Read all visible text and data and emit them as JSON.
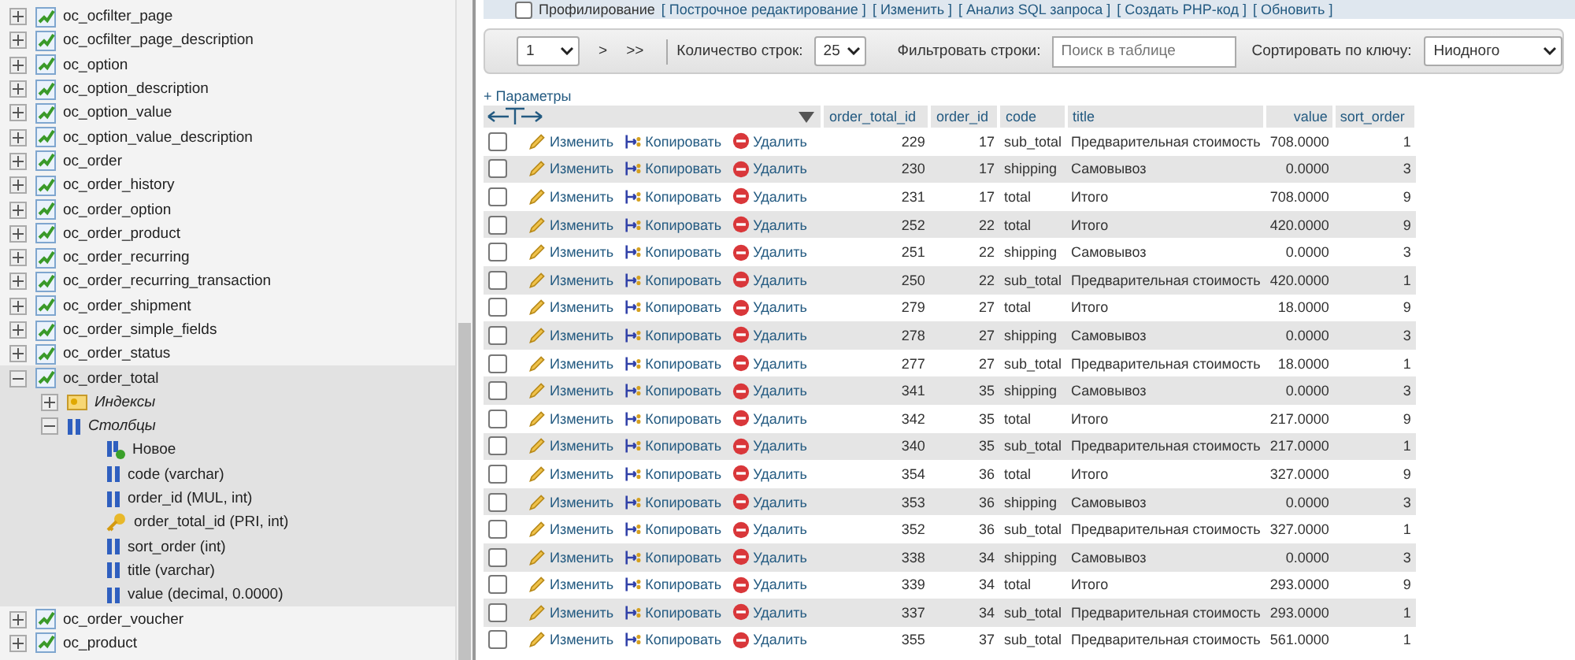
{
  "sidebar": {
    "items": [
      {
        "kind": "table",
        "name": "oc_ocfilter_page",
        "expanded": false
      },
      {
        "kind": "table",
        "name": "oc_ocfilter_page_description",
        "expanded": false
      },
      {
        "kind": "table",
        "name": "oc_option",
        "expanded": false
      },
      {
        "kind": "table",
        "name": "oc_option_description",
        "expanded": false
      },
      {
        "kind": "table",
        "name": "oc_option_value",
        "expanded": false
      },
      {
        "kind": "table",
        "name": "oc_option_value_description",
        "expanded": false
      },
      {
        "kind": "table",
        "name": "oc_order",
        "expanded": false
      },
      {
        "kind": "table",
        "name": "oc_order_history",
        "expanded": false
      },
      {
        "kind": "table",
        "name": "oc_order_option",
        "expanded": false
      },
      {
        "kind": "table",
        "name": "oc_order_product",
        "expanded": false
      },
      {
        "kind": "table",
        "name": "oc_order_recurring",
        "expanded": false
      },
      {
        "kind": "table",
        "name": "oc_order_recurring_transaction",
        "expanded": false
      },
      {
        "kind": "table",
        "name": "oc_order_shipment",
        "expanded": false
      },
      {
        "kind": "table",
        "name": "oc_order_simple_fields",
        "expanded": false
      },
      {
        "kind": "table",
        "name": "oc_order_status",
        "expanded": false
      },
      {
        "kind": "table",
        "name": "oc_order_total",
        "expanded": true,
        "children": [
          {
            "kind": "indexes",
            "name": "Индексы",
            "expanded": false
          },
          {
            "kind": "columns",
            "name": "Столбцы",
            "expanded": true,
            "children": [
              {
                "kind": "new",
                "name": "Новое"
              },
              {
                "kind": "column",
                "name": "code (varchar)"
              },
              {
                "kind": "column",
                "name": "order_id (MUL, int)"
              },
              {
                "kind": "key",
                "name": "order_total_id (PRI, int)"
              },
              {
                "kind": "column",
                "name": "sort_order (int)"
              },
              {
                "kind": "column",
                "name": "title (varchar)"
              },
              {
                "kind": "column",
                "name": "value (decimal, 0.0000)"
              }
            ]
          }
        ]
      },
      {
        "kind": "table",
        "name": "oc_order_voucher",
        "expanded": false
      },
      {
        "kind": "table",
        "name": "oc_product",
        "expanded": false
      }
    ]
  },
  "top_links": {
    "checkbox_checked": false,
    "checkbox_label": "Профилирование",
    "links": [
      "[ Построчное редактирование ]",
      "[ Изменить ]",
      "[ Анализ SQL запроса ]",
      "[ Создать PHP-код ]",
      "[ Обновить ]"
    ]
  },
  "navigation": {
    "page": "1",
    "next": ">",
    "last": ">>",
    "rows_label": "Количество строк:",
    "rows_value": "25",
    "filter_label": "Фильтровать строки:",
    "filter_placeholder": "Поиск в таблице",
    "sort_label": "Сортировать по ключу:",
    "sort_value": "Ниодного"
  },
  "options_link": "+ Параметры",
  "table": {
    "columns": [
      "order_total_id",
      "order_id",
      "code",
      "title",
      "value",
      "sort_order"
    ],
    "rows": [
      {
        "checked": false,
        "edit": "Изменить",
        "copy": "Копировать",
        "delete": "Удалить",
        "cells": [
          "229",
          "17",
          "sub_total",
          "Предварительная стоимость",
          "708.0000",
          "1"
        ]
      },
      {
        "checked": false,
        "edit": "Изменить",
        "copy": "Копировать",
        "delete": "Удалить",
        "cells": [
          "230",
          "17",
          "shipping",
          "Самовывоз",
          "0.0000",
          "3"
        ]
      },
      {
        "checked": false,
        "edit": "Изменить",
        "copy": "Копировать",
        "delete": "Удалить",
        "cells": [
          "231",
          "17",
          "total",
          "Итого",
          "708.0000",
          "9"
        ]
      },
      {
        "checked": false,
        "edit": "Изменить",
        "copy": "Копировать",
        "delete": "Удалить",
        "cells": [
          "252",
          "22",
          "total",
          "Итого",
          "420.0000",
          "9"
        ]
      },
      {
        "checked": false,
        "edit": "Изменить",
        "copy": "Копировать",
        "delete": "Удалить",
        "cells": [
          "251",
          "22",
          "shipping",
          "Самовывоз",
          "0.0000",
          "3"
        ]
      },
      {
        "checked": false,
        "edit": "Изменить",
        "copy": "Копировать",
        "delete": "Удалить",
        "cells": [
          "250",
          "22",
          "sub_total",
          "Предварительная стоимость",
          "420.0000",
          "1"
        ]
      },
      {
        "checked": false,
        "edit": "Изменить",
        "copy": "Копировать",
        "delete": "Удалить",
        "cells": [
          "279",
          "27",
          "total",
          "Итого",
          "18.0000",
          "9"
        ]
      },
      {
        "checked": false,
        "edit": "Изменить",
        "copy": "Копировать",
        "delete": "Удалить",
        "cells": [
          "278",
          "27",
          "shipping",
          "Самовывоз",
          "0.0000",
          "3"
        ]
      },
      {
        "checked": false,
        "edit": "Изменить",
        "copy": "Копировать",
        "delete": "Удалить",
        "cells": [
          "277",
          "27",
          "sub_total",
          "Предварительная стоимость",
          "18.0000",
          "1"
        ]
      },
      {
        "checked": false,
        "edit": "Изменить",
        "copy": "Копировать",
        "delete": "Удалить",
        "cells": [
          "341",
          "35",
          "shipping",
          "Самовывоз",
          "0.0000",
          "3"
        ]
      },
      {
        "checked": false,
        "edit": "Изменить",
        "copy": "Копировать",
        "delete": "Удалить",
        "cells": [
          "342",
          "35",
          "total",
          "Итого",
          "217.0000",
          "9"
        ]
      },
      {
        "checked": false,
        "edit": "Изменить",
        "copy": "Копировать",
        "delete": "Удалить",
        "cells": [
          "340",
          "35",
          "sub_total",
          "Предварительная стоимость",
          "217.0000",
          "1"
        ]
      },
      {
        "checked": false,
        "edit": "Изменить",
        "copy": "Копировать",
        "delete": "Удалить",
        "cells": [
          "354",
          "36",
          "total",
          "Итого",
          "327.0000",
          "9"
        ]
      },
      {
        "checked": false,
        "edit": "Изменить",
        "copy": "Копировать",
        "delete": "Удалить",
        "cells": [
          "353",
          "36",
          "shipping",
          "Самовывоз",
          "0.0000",
          "3"
        ]
      },
      {
        "checked": false,
        "edit": "Изменить",
        "copy": "Копировать",
        "delete": "Удалить",
        "cells": [
          "352",
          "36",
          "sub_total",
          "Предварительная стоимость",
          "327.0000",
          "1"
        ]
      },
      {
        "checked": false,
        "edit": "Изменить",
        "copy": "Копировать",
        "delete": "Удалить",
        "cells": [
          "338",
          "34",
          "shipping",
          "Самовывоз",
          "0.0000",
          "3"
        ]
      },
      {
        "checked": false,
        "edit": "Изменить",
        "copy": "Копировать",
        "delete": "Удалить",
        "cells": [
          "339",
          "34",
          "total",
          "Итого",
          "293.0000",
          "9"
        ]
      },
      {
        "checked": false,
        "edit": "Изменить",
        "copy": "Копировать",
        "delete": "Удалить",
        "cells": [
          "337",
          "34",
          "sub_total",
          "Предварительная стоимость",
          "293.0000",
          "1"
        ]
      },
      {
        "checked": false,
        "edit": "Изменить",
        "copy": "Копировать",
        "delete": "Удалить",
        "cells": [
          "355",
          "37",
          "sub_total",
          "Предварительная стоимость",
          "561.0000",
          "1"
        ]
      }
    ]
  }
}
